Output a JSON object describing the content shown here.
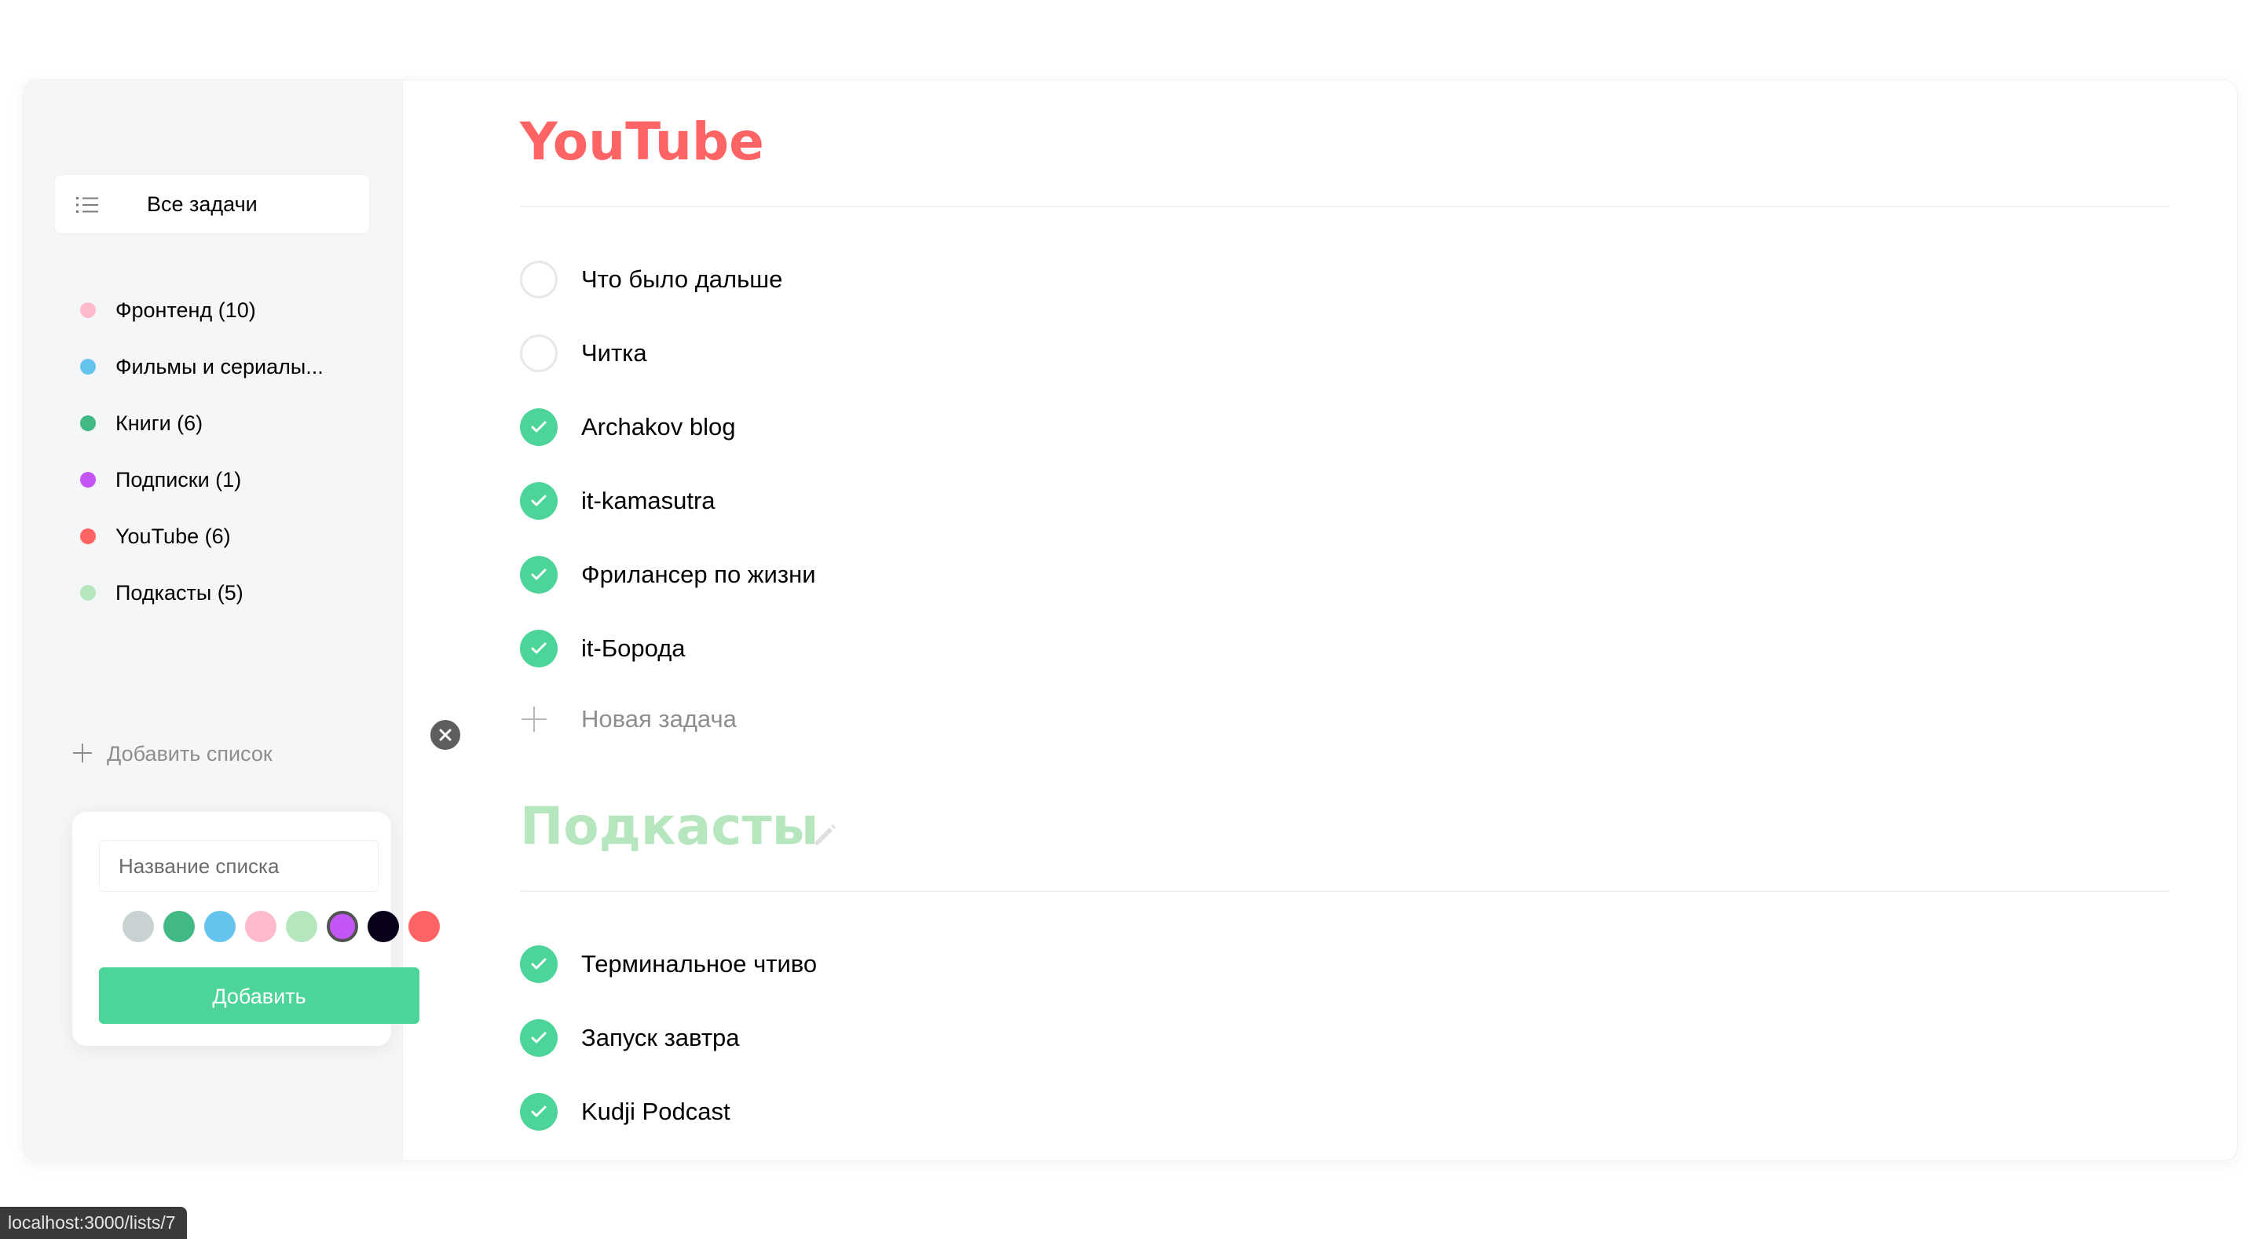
{
  "colors": {
    "accent": "#4dd599",
    "sidebar_bg": "#f4f6f8",
    "youtube": "#ff6464",
    "podcasts": "#b6e6bd"
  },
  "sidebar": {
    "all_tasks": {
      "label": "Все задачи",
      "icon": "list-icon"
    },
    "lists": [
      {
        "name": "Фронтенд (10)",
        "color": "#ffbbcc"
      },
      {
        "name": "Фильмы и сериалы...",
        "color": "#64c4ed"
      },
      {
        "name": "Книги (6)",
        "color": "#42b883"
      },
      {
        "name": "Подписки (1)",
        "color": "#c355f5"
      },
      {
        "name": "YouTube (6)",
        "color": "#ff6464"
      },
      {
        "name": "Подкасты (5)",
        "color": "#b6e6bd"
      }
    ],
    "add_list_label": "Добавить список"
  },
  "popup": {
    "input_placeholder": "Название списка",
    "colors": [
      "#c9d1d3",
      "#42b883",
      "#64c4ed",
      "#ffbbcc",
      "#b6e6bd",
      "#c355f5",
      "#09011a",
      "#ff6464"
    ],
    "selected_color_index": 5,
    "submit_label": "Добавить"
  },
  "main": {
    "sections": [
      {
        "title": "YouTube",
        "color": "#ff6464",
        "tasks": [
          {
            "text": "Что было дальше",
            "completed": false
          },
          {
            "text": "Читка",
            "completed": false
          },
          {
            "text": "Archakov blog",
            "completed": true
          },
          {
            "text": "it-kamasutra",
            "completed": true
          },
          {
            "text": "Фрилансер по жизни",
            "completed": true
          },
          {
            "text": "it-Борода",
            "completed": true
          }
        ],
        "new_task_label": "Новая задача"
      },
      {
        "title": "Подкасты",
        "color": "#b6e6bd",
        "tasks": [
          {
            "text": "Терминальное чтиво",
            "completed": true
          },
          {
            "text": "Запуск завтра",
            "completed": true
          },
          {
            "text": "Kudji Podcast",
            "completed": true
          }
        ]
      }
    ]
  },
  "statusbar": {
    "url": "localhost:3000/lists/7"
  }
}
